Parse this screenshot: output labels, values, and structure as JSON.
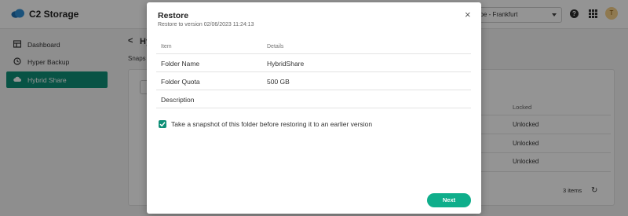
{
  "app": {
    "title": "C2 Storage",
    "region": "ope - Frankfurt",
    "avatar_initial": "T",
    "help_glyph": "?"
  },
  "sidebar": {
    "items": [
      {
        "label": "Dashboard",
        "icon": "dashboard-icon",
        "active": false
      },
      {
        "label": "Hyper Backup",
        "icon": "backup-icon",
        "active": false
      },
      {
        "label": "Hybrid Share",
        "icon": "cloud-icon",
        "active": true
      }
    ]
  },
  "main": {
    "back_glyph": "<",
    "title": "Hy",
    "snaps_label": "Snaps",
    "table": {
      "locked_header": "Locked",
      "locked_values": [
        "Unlocked",
        "Unlocked",
        "Unlocked"
      ]
    },
    "footer": {
      "items_count": "3 items",
      "refresh_glyph": "↻"
    }
  },
  "dialog": {
    "title": "Restore",
    "subtitle": "Restore to version 02/06/2023 11:24:13",
    "close_glyph": "×",
    "columns": [
      "Item",
      "Details"
    ],
    "rows": [
      {
        "item": "Folder Name",
        "details": "HybridShare"
      },
      {
        "item": "Folder Quota",
        "details": "500 GB"
      },
      {
        "item": "Description",
        "details": ""
      }
    ],
    "snapshot_checkbox": {
      "label": "Take a snapshot of this folder before restoring it to an earlier version",
      "checked": true
    },
    "next_button": "Next"
  },
  "colors": {
    "accent": "#0e8f77",
    "button": "#0fae8b",
    "overlay": "rgba(0,0,0,0.42)"
  }
}
